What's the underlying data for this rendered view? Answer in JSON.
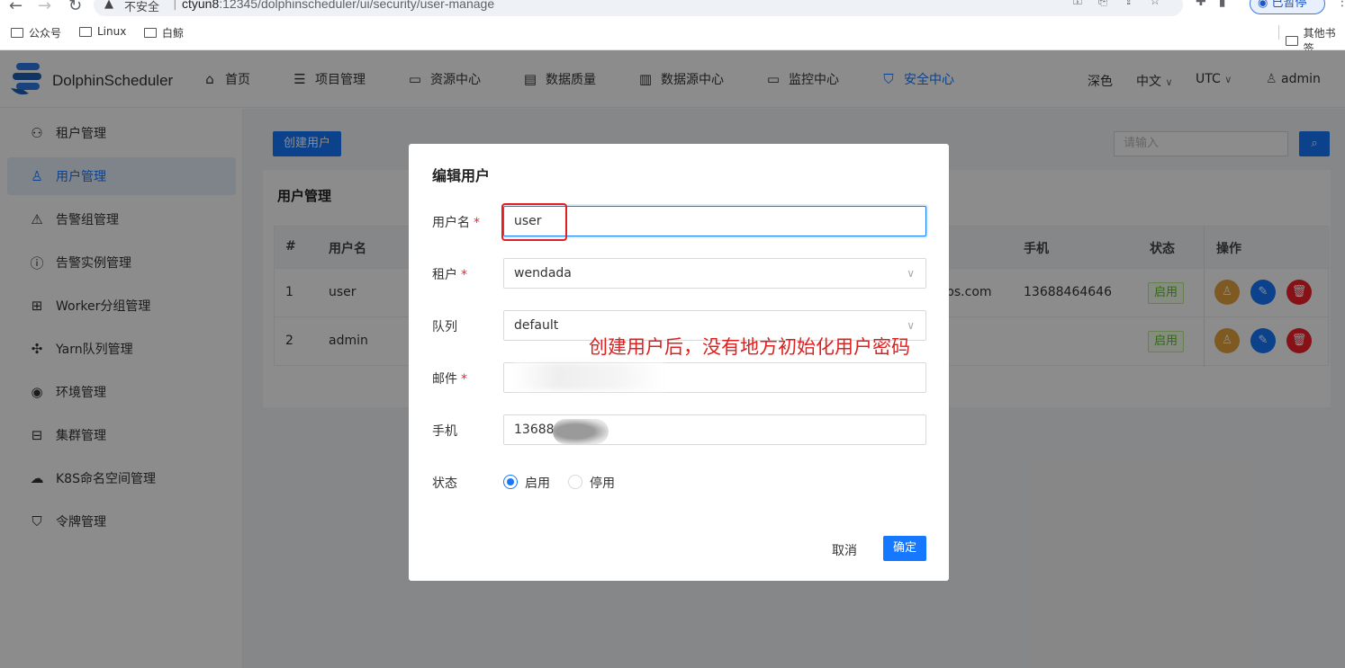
{
  "browser": {
    "security_label": "不安全",
    "url_host": "ctyun8",
    "url_rest": ":12345/dolphinscheduler/ui/security/user-manage",
    "profile_label": "已暂停",
    "bookmarks": [
      "公众号",
      "Linux",
      "白鲸"
    ],
    "other_bookmarks": "其他书签"
  },
  "app": {
    "brand": "DolphinScheduler",
    "menu": [
      {
        "label": "首页",
        "icon": "home-icon"
      },
      {
        "label": "项目管理",
        "icon": "project-icon"
      },
      {
        "label": "资源中心",
        "icon": "folder-icon"
      },
      {
        "label": "数据质量",
        "icon": "quality-icon"
      },
      {
        "label": "数据源中心",
        "icon": "datasource-icon"
      },
      {
        "label": "监控中心",
        "icon": "monitor-icon"
      },
      {
        "label": "安全中心",
        "icon": "shield-icon"
      }
    ],
    "theme": "深色",
    "language": "中文",
    "timezone": "UTC",
    "user": "admin"
  },
  "sidebar": {
    "items": [
      {
        "label": "租户管理",
        "icon": "tenant-icon"
      },
      {
        "label": "用户管理",
        "icon": "user-icon"
      },
      {
        "label": "告警组管理",
        "icon": "warning-icon"
      },
      {
        "label": "告警实例管理",
        "icon": "info-icon"
      },
      {
        "label": "Worker分组管理",
        "icon": "worker-icon"
      },
      {
        "label": "Yarn队列管理",
        "icon": "yarn-icon"
      },
      {
        "label": "环境管理",
        "icon": "location-icon"
      },
      {
        "label": "集群管理",
        "icon": "cluster-icon"
      },
      {
        "label": "K8S命名空间管理",
        "icon": "k8s-icon"
      },
      {
        "label": "令牌管理",
        "icon": "token-icon"
      }
    ]
  },
  "main": {
    "create_button": "创建用户",
    "search_placeholder": "请输入",
    "card_title": "用户管理",
    "columns": [
      "#",
      "用户名",
      "手机",
      "状态",
      "操作"
    ],
    "rows": [
      {
        "index": "1",
        "username": "user",
        "email_tail": "ps.com",
        "phone": "13688464646",
        "status": "启用"
      },
      {
        "index": "2",
        "username": "admin",
        "email_tail": "",
        "phone": "",
        "status": "启用"
      }
    ]
  },
  "modal": {
    "title": "编辑用户",
    "fields": {
      "username_label": "用户名",
      "username_value": "user",
      "tenant_label": "租户",
      "tenant_value": "wendada",
      "queue_label": "队列",
      "queue_value": "default",
      "email_label": "邮件",
      "phone_label": "手机",
      "phone_value": "13688",
      "state_label": "状态",
      "state_options": [
        "启用",
        "停用"
      ],
      "state_selected": "启用"
    },
    "cancel": "取消",
    "confirm": "确定",
    "annotation": "创建用户后，没有地方初始化用户密码"
  },
  "colors": {
    "primary": "#1677ff",
    "annotation": "#e02020",
    "success": "#52c41a",
    "warning": "#e6a23c",
    "danger": "#f5222d"
  }
}
